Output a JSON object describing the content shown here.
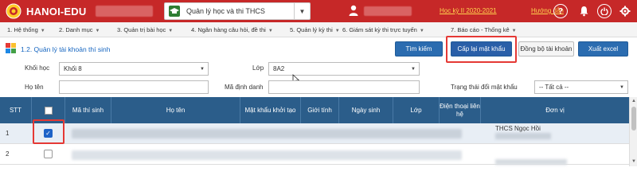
{
  "header": {
    "brand": "HANOI-EDU",
    "module_select": "Quản lý học và thi THCS",
    "semester": "Học kỳ II 2020-2021",
    "guide": "Hướng dẫn",
    "colors": {
      "primary": "#c62828",
      "link": "#ffd54f"
    }
  },
  "menu": {
    "items": [
      "1. Hệ thống",
      "2. Danh mục",
      "3. Quản trị bài học",
      "4. Ngân hàng câu hỏi, đề thi",
      "5. Quản lý kỳ thi",
      "6. Giám sát kỳ thi trực tuyến",
      "7. Báo cáo - Thống kê"
    ]
  },
  "page": {
    "title": "1.2. Quản lý tài khoản thí sinh",
    "buttons": {
      "search": "Tìm kiếm",
      "reset_password": "Cấp lại mật khẩu",
      "sync_account": "Đồng bộ tài khoản",
      "export_excel": "Xuất excel"
    }
  },
  "filters": {
    "grade_label": "Khối học",
    "grade_value": "Khối 8",
    "class_label": "Lớp",
    "class_value": "8A2",
    "name_label": "Họ tên",
    "id_label": "Mã định danh",
    "status_label": "Trạng thái đổi mật khẩu",
    "status_value": "-- Tất cả --"
  },
  "table": {
    "headers": [
      "STT",
      "",
      "Mã thí sinh",
      "Họ tên",
      "Mật khẩu khởi tạo",
      "Giới tính",
      "Ngày sinh",
      "Lớp",
      "Điện thoại liên hệ",
      "Đơn vị"
    ],
    "rows": [
      {
        "stt": "1",
        "checked": true,
        "unit": "THCS Ngọc Hồi"
      },
      {
        "stt": "2",
        "checked": false,
        "unit": ""
      }
    ]
  }
}
